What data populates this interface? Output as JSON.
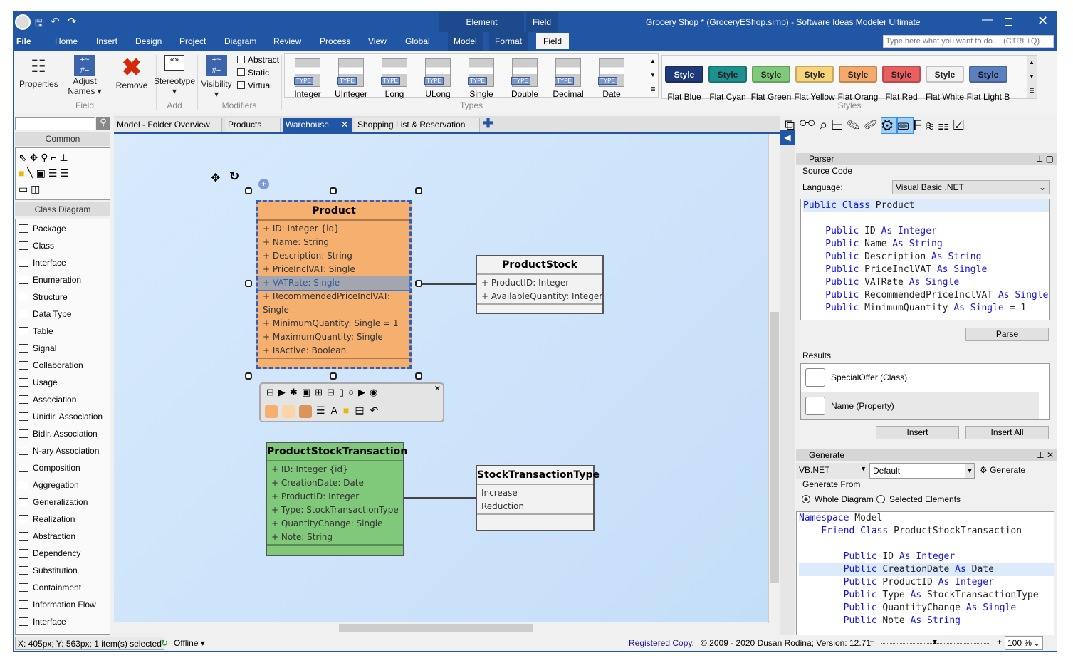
{
  "window": {
    "title": "Grocery Shop *  (GroceryEShop.simp)  - Software Ideas Modeler Ultimate",
    "search_placeholder": "Type here what you want to do...  (CTRL+Q)"
  },
  "context_groups": [
    "Element",
    "Field"
  ],
  "menu": [
    "File",
    "Home",
    "Insert",
    "Design",
    "Project",
    "Diagram",
    "Review",
    "Process",
    "View",
    "Global",
    "Model",
    "Format",
    "Field"
  ],
  "ribbon": {
    "field": {
      "properties": "Properties",
      "adjust": "Adjust",
      "names": "Names",
      "remove": "Remove",
      "group": "Field"
    },
    "add": {
      "stereotype": "Stereotype",
      "group": "Add"
    },
    "modifiers": {
      "visibility": "Visibility",
      "checks": [
        "Abstract",
        "Static",
        "Virtual"
      ],
      "group": "Modifiers"
    },
    "types": {
      "items": [
        "Integer",
        "UInteger",
        "Long",
        "ULong",
        "Single",
        "Double",
        "Decimal",
        "Date"
      ],
      "icon_text": "TYPE",
      "group": "Types"
    },
    "styles": {
      "button_text": "Style",
      "group": "Styles",
      "items": [
        {
          "name": "Flat Blue",
          "bg": "#1f3a7a",
          "fg": "#ffffff"
        },
        {
          "name": "Flat Cyan",
          "bg": "#1f9090",
          "fg": "#222222"
        },
        {
          "name": "Flat Green",
          "bg": "#80c87a",
          "fg": "#222222"
        },
        {
          "name": "Flat Yellow",
          "bg": "#f8d47a",
          "fg": "#222222"
        },
        {
          "name": "Flat Orang",
          "bg": "#f5a96a",
          "fg": "#222222"
        },
        {
          "name": "Flat Red",
          "bg": "#ea6060",
          "fg": "#222222"
        },
        {
          "name": "Flat White",
          "bg": "#f2f2f2",
          "fg": "#222222"
        },
        {
          "name": "Flat Light B",
          "bg": "#5b7fc0",
          "fg": "#111111"
        }
      ]
    }
  },
  "toolbox": {
    "common": "Common",
    "class_diagram": "Class Diagram",
    "items": [
      "Package",
      "Class",
      "Interface",
      "Enumeration",
      "Structure",
      "Data Type",
      "Table",
      "Signal",
      "Collaboration",
      "Usage",
      "Association",
      "Unidir. Association",
      "Bidir. Association",
      "N-ary Association",
      "Composition",
      "Aggregation",
      "Generalization",
      "Realization",
      "Abstraction",
      "Dependency",
      "Substitution",
      "Containment",
      "Information Flow",
      "Interface"
    ]
  },
  "tabs": [
    {
      "label": "Model - Folder Overview"
    },
    {
      "label": "Products"
    },
    {
      "label": "Warehouse",
      "active": true
    },
    {
      "label": "Shopping List & Reservation"
    }
  ],
  "diagram": {
    "product": {
      "name": "Product",
      "color": "#f5b070",
      "attributes": [
        "+ ID: Integer {id}",
        "+ Name: String",
        "+ Description: String",
        "+ PriceInclVAT: Single",
        "+ VATRate: Single",
        "+ RecommendedPriceInclVAT:",
        "Single",
        "+ MinimumQuantity: Single = 1",
        "+ MaximumQuantity: Single",
        "+ IsActive: Boolean"
      ],
      "selected_attribute": "+ VATRate: Single"
    },
    "product_stock": {
      "name": "ProductStock",
      "color": "#f2f2f2",
      "attributes": [
        "+ ProductID: Integer",
        "+ AvailableQuantity: Integer"
      ]
    },
    "transaction": {
      "name": "ProductStockTransaction",
      "color": "#80c87a",
      "attributes": [
        "+ ID: Integer {id}",
        "+ CreationDate: Date",
        "+ ProductID: Integer",
        "+ Type: StockTransactionType",
        "+ QuantityChange: Single",
        "+ Note: String"
      ]
    },
    "transaction_type": {
      "name": "StockTransactionType",
      "color": "#f2f2f2",
      "literals": [
        "Increase",
        "Reduction"
      ]
    },
    "quick_colors": [
      "#f5b070",
      "#fbd4a8",
      "#d9955a"
    ]
  },
  "parser": {
    "title": "Parser",
    "source_code": "Source Code",
    "language_label": "Language:",
    "language": "Visual Basic .NET",
    "code": [
      [
        [
          "Public Class ",
          1
        ],
        [
          "Product",
          0
        ]
      ],
      [],
      [
        [
          "    Public ",
          1
        ],
        [
          "ID ",
          0
        ],
        [
          "As Integer",
          1
        ]
      ],
      [
        [
          "    Public ",
          1
        ],
        [
          "Name ",
          0
        ],
        [
          "As String",
          1
        ]
      ],
      [
        [
          "    Public ",
          1
        ],
        [
          "Description ",
          0
        ],
        [
          "As String",
          1
        ]
      ],
      [
        [
          "    Public ",
          1
        ],
        [
          "PriceInclVAT ",
          0
        ],
        [
          "As Single",
          1
        ]
      ],
      [
        [
          "    Public ",
          1
        ],
        [
          "VATRate ",
          0
        ],
        [
          "As Single",
          1
        ]
      ],
      [
        [
          "    Public ",
          1
        ],
        [
          "RecommendedPriceInclVAT ",
          0
        ],
        [
          "As Single",
          1
        ]
      ],
      [
        [
          "    Public ",
          1
        ],
        [
          "MinimumQuantity ",
          0
        ],
        [
          "As Single",
          1
        ],
        [
          " = 1",
          0
        ]
      ]
    ],
    "parse": "Parse",
    "results_label": "Results",
    "results": [
      "SpecialOffer (Class)",
      "Name (Property)"
    ],
    "insert": "Insert",
    "insert_all": "Insert All"
  },
  "generate": {
    "title": "Generate",
    "language": "VB.NET",
    "template": "Default",
    "button": "Generate",
    "from_label": "Generate From",
    "options": [
      {
        "label": "Whole Diagram",
        "checked": true
      },
      {
        "label": "Selected Elements",
        "checked": false
      }
    ],
    "code": [
      [
        [
          "Namespace ",
          1
        ],
        [
          "Model",
          0
        ]
      ],
      [
        [
          "    Friend Class ",
          1
        ],
        [
          "ProductStockTransaction",
          0
        ]
      ],
      [],
      [
        [
          "        Public ",
          1
        ],
        [
          "ID ",
          0
        ],
        [
          "As Integer",
          1
        ]
      ],
      [
        [
          "        Public ",
          1
        ],
        [
          "CreationDate ",
          0
        ],
        [
          "As ",
          1
        ],
        [
          "Date",
          0
        ]
      ],
      [
        [
          "        Public ",
          1
        ],
        [
          "ProductID ",
          0
        ],
        [
          "As Integer",
          1
        ]
      ],
      [
        [
          "        Public ",
          1
        ],
        [
          "Type ",
          0
        ],
        [
          "As ",
          1
        ],
        [
          "StockTransactionType",
          0
        ]
      ],
      [
        [
          "        Public ",
          1
        ],
        [
          "QuantityChange ",
          0
        ],
        [
          "As Single",
          1
        ]
      ],
      [
        [
          "        Public ",
          1
        ],
        [
          "Note ",
          0
        ],
        [
          "As String",
          1
        ]
      ]
    ]
  },
  "status": {
    "position": "X: 405px; Y: 563px; 1 item(s) selected",
    "connection": "Offline",
    "registered": "Registered Copy.",
    "copyright": "© 2009 - 2020 Dusan Rodina; Version: 12.71",
    "zoom": "100 %"
  }
}
